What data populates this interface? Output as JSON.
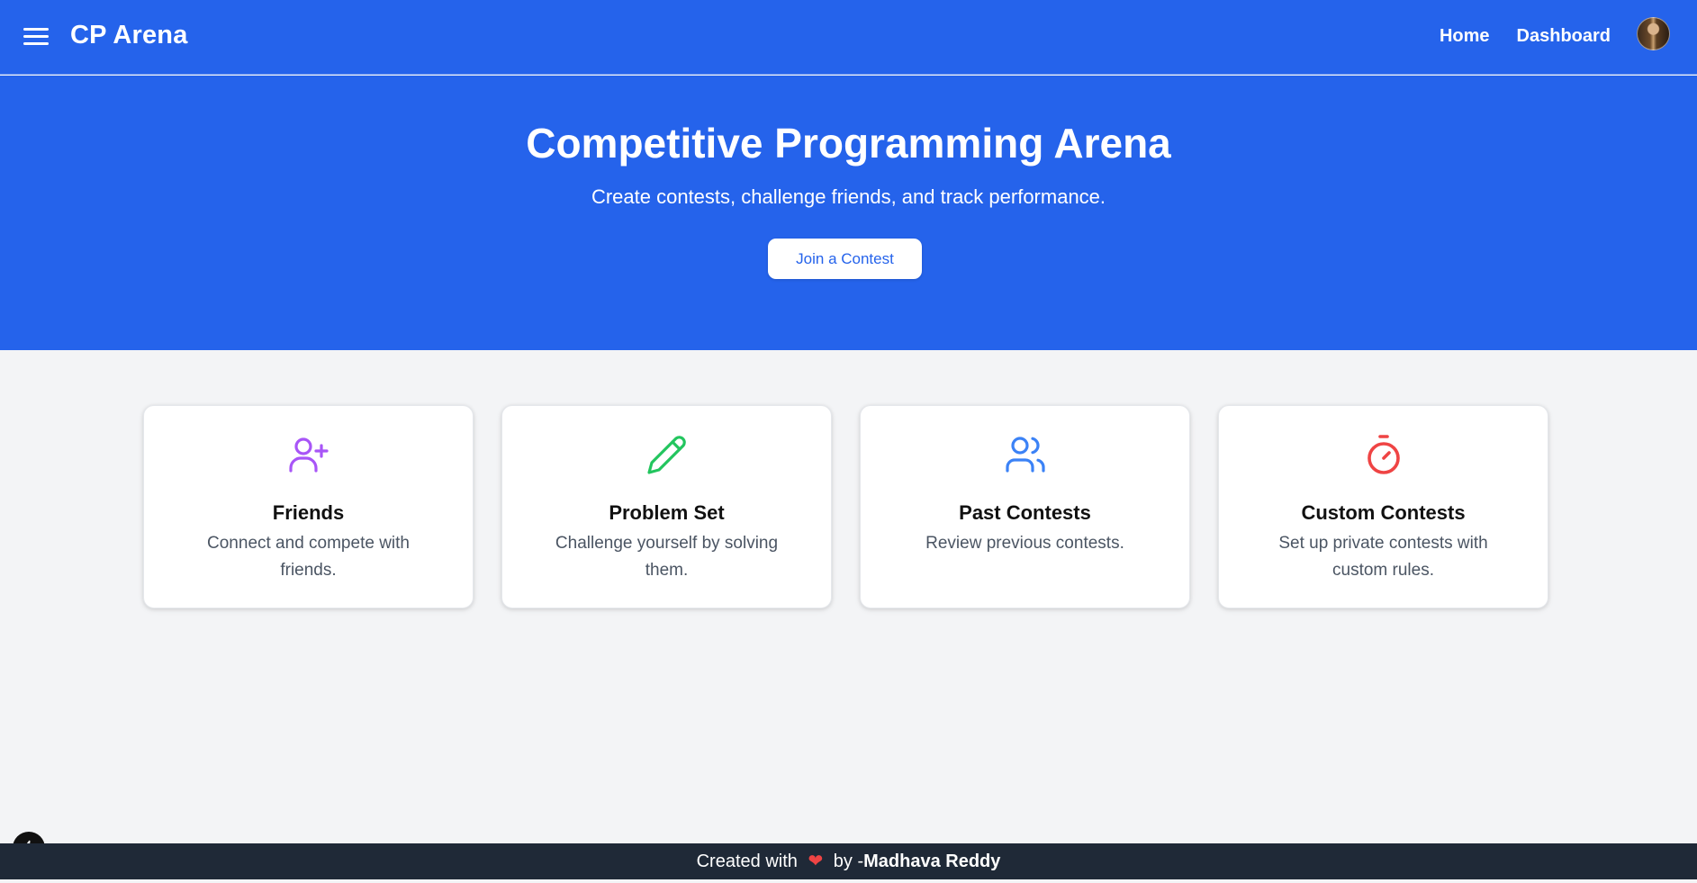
{
  "navbar": {
    "brand": "CP Arena",
    "links": [
      {
        "label": "Home"
      },
      {
        "label": "Dashboard"
      }
    ],
    "menu_icon": "hamburger-icon",
    "avatar": "user-avatar"
  },
  "hero": {
    "title": "Competitive Programming Arena",
    "subtitle": "Create contests, challenge friends, and track performance.",
    "cta_label": "Join a Contest"
  },
  "cards": [
    {
      "title": "Friends",
      "description": "Connect and compete with friends.",
      "icon": "user-plus-icon",
      "color": "#a855f7"
    },
    {
      "title": "Problem Set",
      "description": "Challenge yourself by solving them.",
      "icon": "pencil-icon",
      "color": "#22c55e"
    },
    {
      "title": "Past Contests",
      "description": "Review previous contests.",
      "icon": "users-icon",
      "color": "#3b82f6"
    },
    {
      "title": "Custom Contests",
      "description": "Set up private contests with custom rules.",
      "icon": "timer-icon",
      "color": "#ef4444"
    }
  ],
  "footer": {
    "prefix": "Created with",
    "heart": "❤",
    "by": "by -",
    "author": "Madhava Reddy"
  },
  "colors": {
    "primary": "#2563eb",
    "background": "#f3f4f6",
    "footer": "#1f2937"
  }
}
